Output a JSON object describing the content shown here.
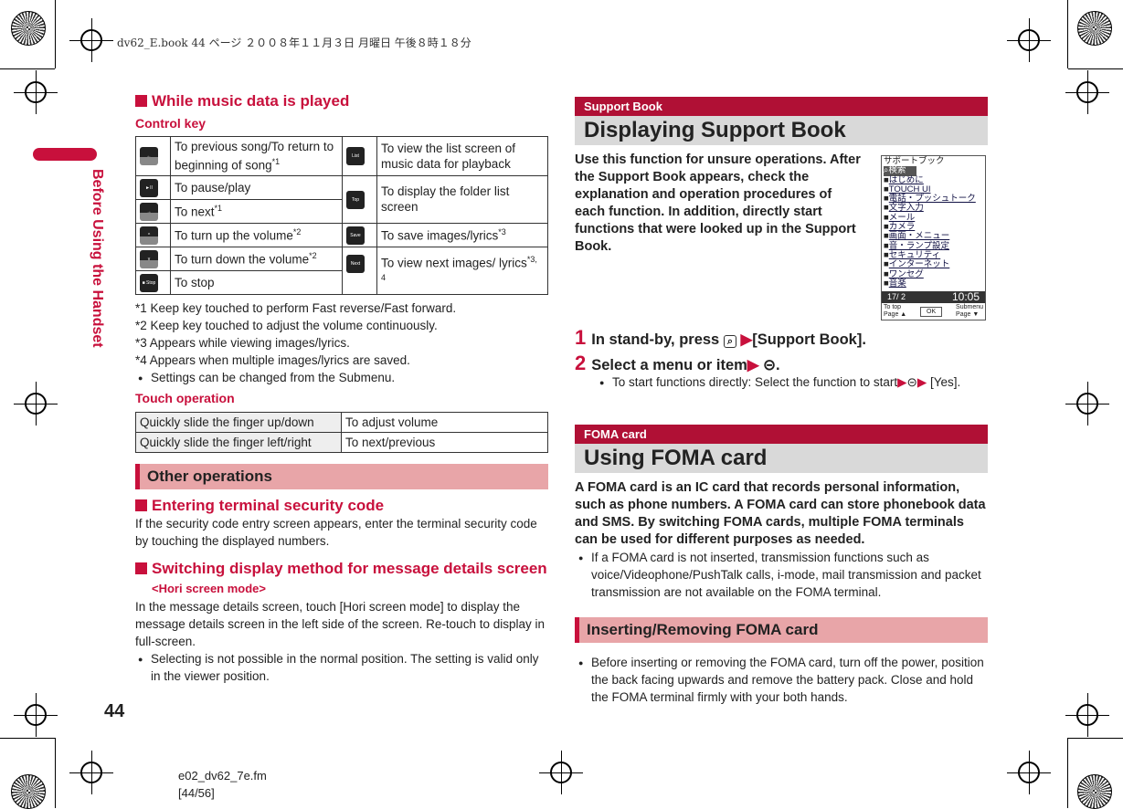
{
  "header": {
    "running_head": "dv62_E.book  44 ページ  ２００８年１１月３日  月曜日  午後８時１８分"
  },
  "side": {
    "title": "Before Using the Handset",
    "page_number": "44",
    "file": "e02_dv62_7e.fm",
    "page_range": "[44/56]"
  },
  "left": {
    "music_heading": "While music data is played",
    "control_key_label": "Control key",
    "control_rows_left": [
      {
        "icon": "previous-key-icon",
        "key": "←",
        "text": "To previous song/To return to beginning of song",
        "sup": "*1"
      },
      {
        "icon": "play-pause-key-icon",
        "key": "►II",
        "text": "To pause/play",
        "sup": ""
      },
      {
        "icon": "next-key-icon",
        "key": "→",
        "text": "To next",
        "sup": "*1"
      },
      {
        "icon": "volume-up-key-icon",
        "key": "^",
        "text": "To turn up the volume",
        "sup": "*2"
      },
      {
        "icon": "volume-down-key-icon",
        "key": "v",
        "text": "To turn down the volume",
        "sup": "*2"
      },
      {
        "icon": "stop-key-icon",
        "key": "■ Stop",
        "text": "To stop",
        "sup": ""
      }
    ],
    "control_rows_right": [
      {
        "icon": "list-key-icon",
        "key": "List",
        "text": "To view the list screen of music data for playback",
        "sup": ""
      },
      {
        "icon": "top-key-icon",
        "key": "Top",
        "text": "To display the folder list screen",
        "sup": ""
      },
      {
        "icon": "save-key-icon",
        "key": "Save",
        "text": "To save images/lyrics",
        "sup": "*3"
      },
      {
        "icon": "next-picture-key-icon",
        "key": "Next Picture",
        "text": "To view next images/ lyrics",
        "sup": "*3, 4"
      }
    ],
    "notes": [
      "*1  Keep key touched to perform Fast reverse/Fast forward.",
      "*2  Keep key touched to adjust the volume continuously.",
      "*3  Appears while viewing images/lyrics.",
      "*4  Appears when multiple images/lyrics are saved."
    ],
    "submenu_note": "Settings can be changed from the Submenu.",
    "touch_label": "Touch operation",
    "touch_rows": [
      [
        "Quickly slide the finger up/down",
        "To adjust volume"
      ],
      [
        "Quickly slide the finger left/right",
        "To next/previous"
      ]
    ],
    "other_band": "Other operations",
    "security_heading": "Entering terminal security code",
    "security_text": "If the security code entry screen appears, enter the terminal security code by touching the displayed numbers.",
    "switch_heading": "Switching display method for message details screen",
    "switch_sub": "<Hori screen mode>",
    "switch_text": "In the message details screen, touch [Hori screen mode] to display the message details screen in the left side of the screen. Re-touch to display in full-screen.",
    "switch_bullet": "Selecting is not possible in the normal position. The setting is valid only in the viewer position."
  },
  "right": {
    "support_tag": "Support Book",
    "support_title": "Displaying Support Book",
    "support_text": "Use this function for unsure operations. After the Support Book appears, check the explanation and operation procedures of each function. In addition, directly start functions that were looked up in the Support Book.",
    "phone_screen": {
      "title": "サポートブック",
      "search": "検索",
      "items": [
        "はじめに",
        "TOUCH UI",
        "電話・プッシュトーク",
        "文字入力",
        "メール",
        "カメラ",
        "画面・メニュー",
        "音・ランプ設定",
        "セキュリティ",
        "インターネット",
        "ワンセグ",
        "音楽"
      ],
      "date": "17/ 2",
      "time": "10:05",
      "soft_left": "To top",
      "soft_left2": "Page ▲",
      "soft_center": "OK",
      "soft_right": "Submenu",
      "soft_right2": "Page ▼"
    },
    "step1_pre": "In stand-by, press",
    "step1_post": "[Support Book].",
    "step2": "Select a menu or item",
    "step2_bullet_pre": "To start functions directly: Select the function to start",
    "step2_bullet_post": "[Yes].",
    "foma_tag": "FOMA card",
    "foma_title": "Using FOMA card",
    "foma_text": "A FOMA card is an IC card that records personal information, such as phone numbers. A FOMA card can store phonebook data and SMS. By switching FOMA cards, multiple FOMA terminals can be used for different purposes as needed.",
    "foma_bullet": "If a FOMA card is not inserted, transmission functions such as voice/Videophone/PushTalk calls, i-mode, mail transmission and packet transmission are not available on the FOMA terminal.",
    "insert_band": "Inserting/Removing FOMA card",
    "insert_bullet": "Before inserting or removing the FOMA card, turn off the power, position the back facing upwards and remove the battery pack. Close and hold the FOMA terminal firmly with your both hands."
  },
  "colors": {
    "accent": "#c8103c",
    "band": "#e8a5a8",
    "tag": "#b01035",
    "title_band": "#d9d9d9"
  }
}
